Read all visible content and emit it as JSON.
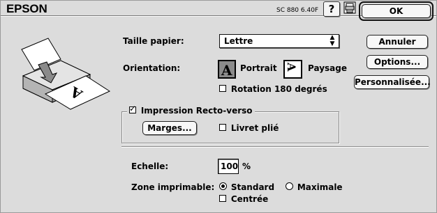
{
  "header": {
    "brand": "EPSON",
    "version": "SC 880 6.40F",
    "help_label": "?",
    "icon": "printer-utility-icon",
    "ok_label": "OK"
  },
  "side_buttons": {
    "cancel": "Annuler",
    "options": "Options...",
    "custom": "Personnalisée..."
  },
  "paper": {
    "label": "Taille papier:",
    "value": "Lettre"
  },
  "orientation": {
    "label": "Orientation:",
    "portrait": "Portrait",
    "landscape": "Paysage",
    "selected": "portrait",
    "rotate_label": "Rotation 180 degrés",
    "rotate_checked": false
  },
  "duplex": {
    "label": "Impression Recto-verso",
    "checked": true,
    "margins_label": "Marges...",
    "booklet_label": "Livret plié",
    "booklet_checked": false
  },
  "scale": {
    "label": "Echelle:",
    "value": "100",
    "unit": "%"
  },
  "printable_area": {
    "label": "Zone imprimable:",
    "standard_label": "Standard",
    "maximal_label": "Maximale",
    "selected": "standard",
    "centered_label": "Centrée",
    "centered_checked": false
  }
}
